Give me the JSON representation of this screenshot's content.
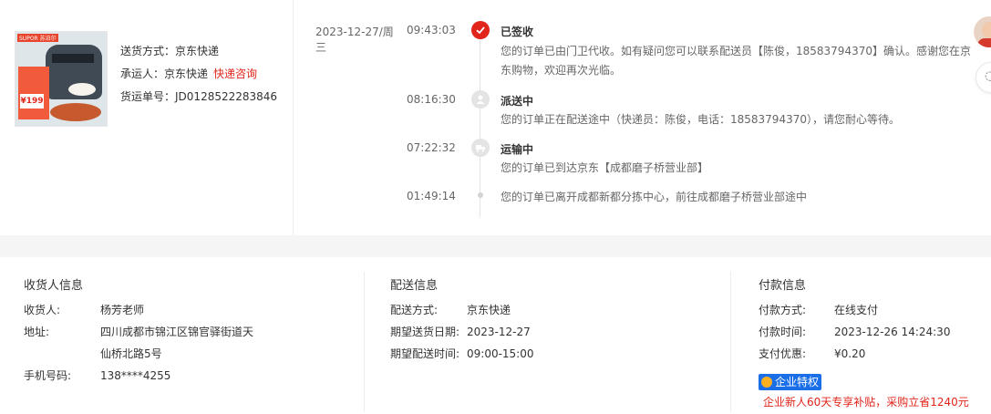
{
  "shipment": {
    "product_image_icon": "product-image",
    "thumb_brand": "SUPOR 苏泊尔",
    "thumb_price": "¥199",
    "method_label": "送货方式：",
    "method_value": "京东快递",
    "carrier_label": "承运人：",
    "carrier_value": "京东快递",
    "carrier_link": "快递咨询",
    "waybill_label": "货运单号：",
    "waybill_value": "JD0128522283846"
  },
  "timeline": {
    "date": "2023-12-27/周三",
    "events": [
      {
        "time": "09:43:03",
        "title": "已签收",
        "icon": "check-icon",
        "text": "您的订单已由门卫代收。如有疑问您可以联系配送员【陈俊，18583794370】确认。感谢您在京东购物，欢迎再次光临。"
      },
      {
        "time": "08:16:30",
        "title": "派送中",
        "icon": "courier-icon",
        "text": "您的订单正在配送途中（快递员：陈俊，电话：18583794370），请您耐心等待。"
      },
      {
        "time": "07:22:32",
        "title": "运输中",
        "icon": "truck-icon",
        "text": "您的订单已到达京东【成都磨子桥营业部】"
      },
      {
        "time": "01:49:14",
        "title": "",
        "icon": "dot-icon",
        "text": "您的订单已离开成都新都分拣中心，前往成都磨子桥营业部途中"
      }
    ]
  },
  "receiver": {
    "heading": "收货人信息",
    "name_label": "收货人:",
    "name_value": "杨芳老师",
    "address_label": "地址:",
    "address_line1": "四川成都市锦江区锦官驿街道天",
    "address_line2": "仙桥北路5号",
    "phone_label": "手机号码:",
    "phone_value": "138****4255"
  },
  "delivery": {
    "heading": "配送信息",
    "method_label": "配送方式:",
    "method_value": "京东快递",
    "date_label": "期望送货日期:",
    "date_value": "2023-12-27",
    "time_label": "期望配送时间:",
    "time_value": "09:00-15:00"
  },
  "payment": {
    "heading": "付款信息",
    "method_label": "付款方式:",
    "method_value": "在线支付",
    "time_label": "付款时间:",
    "time_value": "2023-12-26 14:24:30",
    "discount_label": "支付优惠:",
    "discount_value": "¥0.20",
    "badge_label": "企业特权",
    "promo_text": "企业新人60天专享补贴，采购立省1240元"
  },
  "sidebar": {
    "side_button_icon": "chat-icon"
  },
  "colors": {
    "accent": "#e1251b",
    "badge_blue": "#1a6ee8",
    "divider": "#ededed"
  }
}
